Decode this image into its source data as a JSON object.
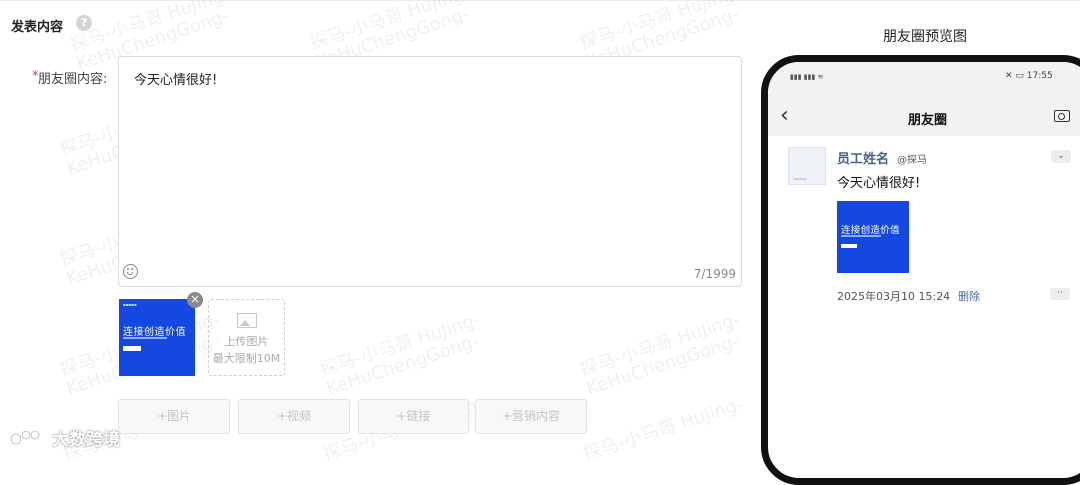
{
  "section": {
    "title": "发表内容",
    "help_icon": "question-icon",
    "help_glyph": "?"
  },
  "form": {
    "required_mark": "*",
    "content_label": "朋友圈内容:",
    "content_value": "今天心情很好!",
    "counter": "7/1999",
    "upload": {
      "line1": "上传图片",
      "line2": "最大限制10M"
    },
    "uploaded_image": {
      "title": "连接创造价值"
    }
  },
  "buttons": {
    "image": "+图片",
    "video": "+视频",
    "link": "+链接",
    "marketing": "+营销内容"
  },
  "preview": {
    "title": "朋友圈预览图",
    "status_time": "17:55",
    "nav_title": "朋友圈",
    "post_name": "员工姓名",
    "post_company": "@探马",
    "post_text": "今天心情很好!",
    "post_image_title": "连接创造价值",
    "post_time": "2025年03月10 15:24",
    "post_delete": "删除"
  },
  "brand_watermark": "大数跨境",
  "watermark": {
    "line1": "探马-小马哥 HuJing-",
    "line2": "KeHuChengGong-"
  },
  "colors": {
    "accent": "#1548e0",
    "required": "#e23c3c",
    "link": "#4a6aa8"
  }
}
